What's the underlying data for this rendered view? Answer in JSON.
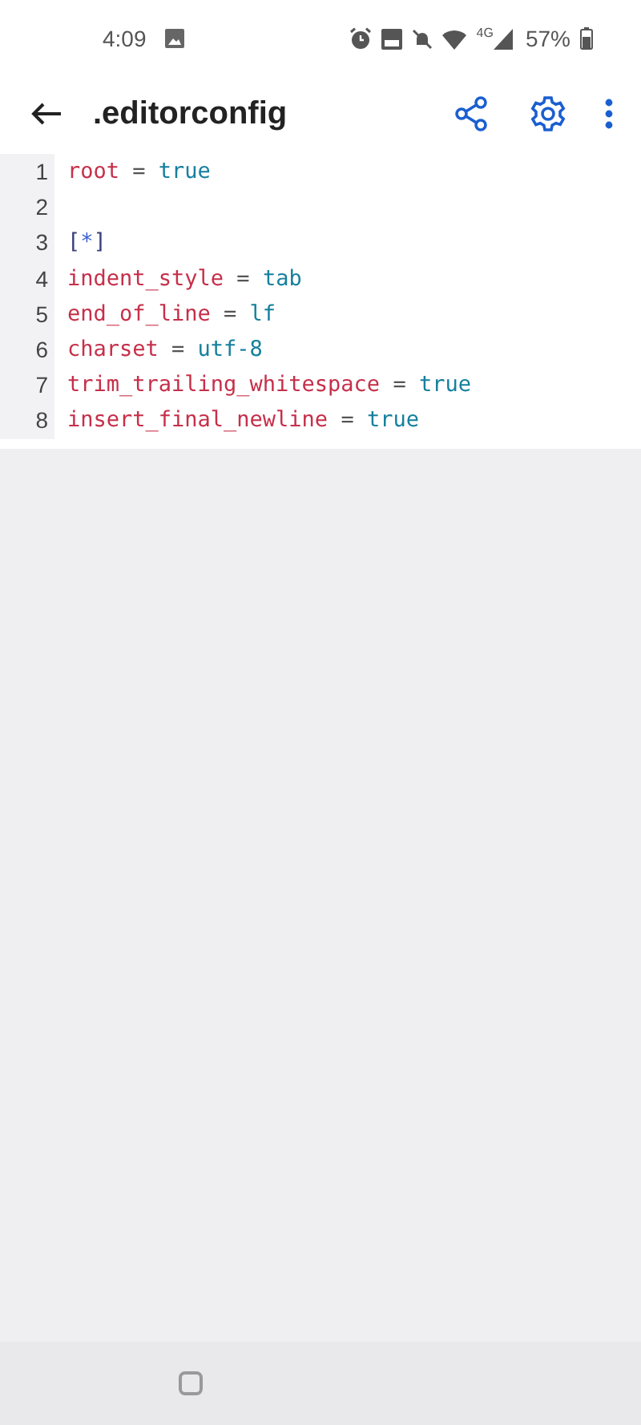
{
  "status_bar": {
    "time": "4:09",
    "battery": "57%",
    "network": "4G"
  },
  "app_bar": {
    "title": ".editorconfig"
  },
  "code": {
    "lines": [
      {
        "number": "1",
        "tokens": [
          {
            "text": "root",
            "kind": "key"
          },
          {
            "text": " = ",
            "kind": "op"
          },
          {
            "text": "true",
            "kind": "value"
          }
        ]
      },
      {
        "number": "2"
      },
      {
        "number": "3",
        "tokens": [
          {
            "text": "[",
            "kind": "punct"
          },
          {
            "text": "*",
            "kind": "glob"
          },
          {
            "text": "]",
            "kind": "punct"
          }
        ]
      },
      {
        "number": "4",
        "tokens": [
          {
            "text": "indent_style",
            "kind": "key"
          },
          {
            "text": " = ",
            "kind": "op"
          },
          {
            "text": "tab",
            "kind": "value"
          }
        ]
      },
      {
        "number": "5",
        "tokens": [
          {
            "text": "end_of_line",
            "kind": "key"
          },
          {
            "text": " = ",
            "kind": "op"
          },
          {
            "text": "lf",
            "kind": "value"
          }
        ]
      },
      {
        "number": "6",
        "tokens": [
          {
            "text": "charset",
            "kind": "key"
          },
          {
            "text": " = ",
            "kind": "op"
          },
          {
            "text": "utf-8",
            "kind": "value"
          }
        ]
      },
      {
        "number": "7",
        "tokens": [
          {
            "text": "trim_trailing_whitespace",
            "kind": "key"
          },
          {
            "text": " = ",
            "kind": "op"
          },
          {
            "text": "true",
            "kind": "value"
          }
        ]
      },
      {
        "number": "8",
        "tokens": [
          {
            "text": "insert_final_newline",
            "kind": "key"
          },
          {
            "text": " = ",
            "kind": "op"
          },
          {
            "text": "true",
            "kind": "value"
          }
        ]
      }
    ]
  }
}
